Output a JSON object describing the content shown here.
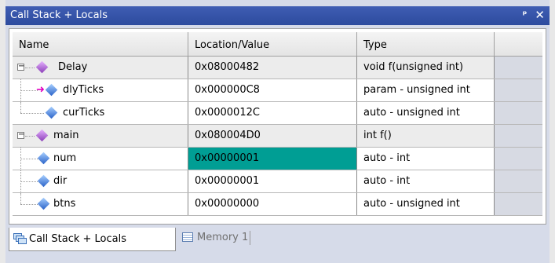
{
  "window": {
    "title": "Call Stack + Locals"
  },
  "columns": [
    "Name",
    "Location/Value",
    "Type"
  ],
  "rows": [
    {
      "name": "Delay",
      "value": "0x08000482",
      "type": "void f(unsigned int)"
    },
    {
      "name": "dlyTicks",
      "value": "0x000000C8",
      "type": "param - unsigned int"
    },
    {
      "name": "curTicks",
      "value": "0x0000012C",
      "type": "auto - unsigned int"
    },
    {
      "name": "main",
      "value": "0x080004D0",
      "type": "int f()"
    },
    {
      "name": "num",
      "value": "0x00000001",
      "type": "auto - int"
    },
    {
      "name": "dir",
      "value": "0x00000001",
      "type": "auto - int"
    },
    {
      "name": "btns",
      "value": "0x00000000",
      "type": "auto - unsigned int"
    }
  ],
  "tabs": [
    {
      "label": "Call Stack + Locals",
      "active": true
    },
    {
      "label": "Memory 1",
      "active": false
    }
  ],
  "colors": {
    "title_bar": "#2d4b9e",
    "highlight_cell": "#009e94",
    "frame_background": "#d6dbe9"
  }
}
